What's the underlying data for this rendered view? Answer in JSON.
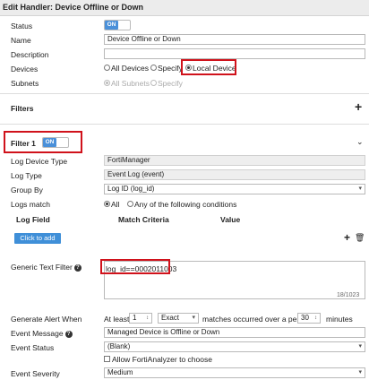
{
  "title": "Edit Handler: Device Offline or Down",
  "fields": {
    "status_label": "Status",
    "status_toggle": "ON",
    "name_label": "Name",
    "name_value": "Device Offline or Down",
    "description_label": "Description",
    "description_value": "",
    "devices_label": "Devices",
    "devices_options": [
      "All Devices",
      "Specify",
      "Local Device"
    ],
    "devices_selected": "Local Device",
    "subnets_label": "Subnets",
    "subnets_options": [
      "All Subnets",
      "Specify"
    ],
    "subnets_selected": "All Subnets"
  },
  "filters": {
    "label": "Filters",
    "add_icon": "plus-icon"
  },
  "filter1": {
    "title": "Filter 1",
    "toggle": "ON",
    "collapse_icon": "chevron-down-icon",
    "log_device_type_label": "Log Device Type",
    "log_device_type_value": "FortiManager",
    "log_type_label": "Log Type",
    "log_type_value": "Event Log (event)",
    "group_by_label": "Group By",
    "group_by_value": "Log ID (log_id)",
    "logs_match_label": "Logs match",
    "logs_match_options": [
      "All",
      "Any of the following conditions"
    ],
    "logs_match_selected": "All",
    "table_headers": [
      "Log Field",
      "Match Criteria",
      "Value"
    ],
    "click_to_add": "Click to add",
    "generic_text_filter_label": "Generic Text Filter",
    "generic_text_filter_value": "log_id==0002011003",
    "char_count": "18/1023"
  },
  "alert": {
    "generate_label": "Generate Alert When",
    "at_least": "At least",
    "count": "1",
    "mode": "Exact",
    "matches_text": "matches occurred over a period of",
    "period": "30",
    "minutes": "minutes",
    "event_message_label": "Event Message",
    "event_message_value": "Managed Device is Offline or Down",
    "event_status_label": "Event Status",
    "event_status_value": "(Blank)",
    "allow_fa_label": "Allow FortiAnalyzer to choose",
    "event_severity_label": "Event Severity",
    "event_severity_value": "Medium"
  },
  "colors": {
    "accent": "#4a90d9",
    "highlight": "#d0121b"
  }
}
